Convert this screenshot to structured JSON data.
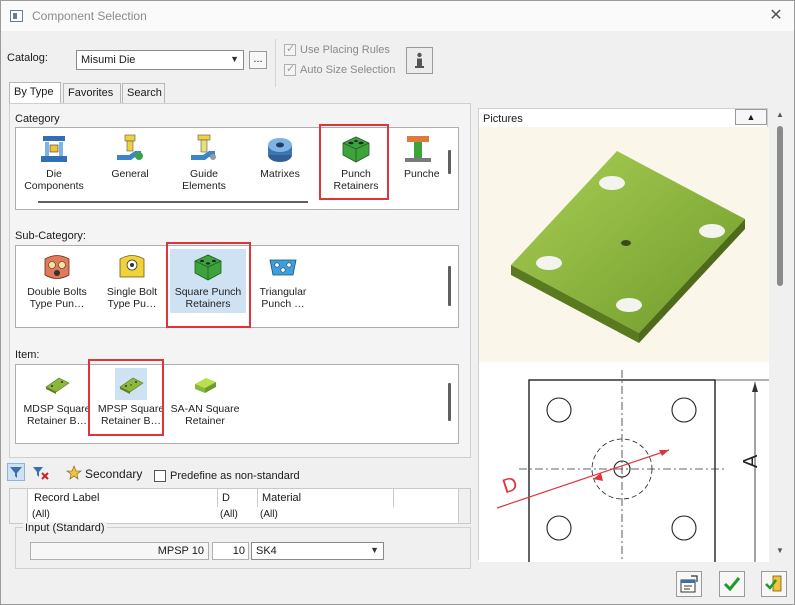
{
  "window": {
    "title": "Component Selection",
    "close_glyph": "✕"
  },
  "catalog": {
    "label": "Catalog:",
    "value": "Misumi Die",
    "browse": "..."
  },
  "options": {
    "use_placing_rules": {
      "label": "Use Placing Rules",
      "checked": true
    },
    "auto_size_selection": {
      "label": "Auto Size Selection",
      "checked": true
    },
    "info_glyph": "i"
  },
  "tabs": [
    {
      "label": "By Type"
    },
    {
      "label": "Favorites"
    },
    {
      "label": "Search"
    }
  ],
  "category": {
    "label": "Category",
    "items": [
      {
        "l1": "Die",
        "l2": "Components",
        "icon": "die-components-icon"
      },
      {
        "l1": "General",
        "l2": "",
        "icon": "general-icon"
      },
      {
        "l1": "Guide",
        "l2": "Elements",
        "icon": "guide-elements-icon"
      },
      {
        "l1": "Matrixes",
        "l2": "",
        "icon": "matrixes-icon"
      },
      {
        "l1": "Punch",
        "l2": "Retainers",
        "icon": "punch-retainers-icon"
      },
      {
        "l1": "Punche",
        "l2": "",
        "icon": "punches-icon"
      }
    ]
  },
  "sub_category": {
    "label": "Sub-Category:",
    "items": [
      {
        "l1": "Double Bolts",
        "l2": "Type Pun…"
      },
      {
        "l1": "Single Bolt",
        "l2": "Type Pu…"
      },
      {
        "l1": "Square Punch",
        "l2": "Retainers"
      },
      {
        "l1": "Triangular",
        "l2": "Punch …"
      }
    ]
  },
  "item": {
    "label": "Item:",
    "items": [
      {
        "l1": "MDSP Square",
        "l2": "Retainer B…"
      },
      {
        "l1": "MPSP Square",
        "l2": "Retainer B…"
      },
      {
        "l1": "SA-AN Square",
        "l2": "Retainer"
      }
    ]
  },
  "bottom_toolbar": {
    "secondary": "Secondary",
    "predefine": {
      "label": "Predefine as non-standard",
      "checked": false
    }
  },
  "table": {
    "columns": [
      "Record Label",
      "D",
      "Material"
    ],
    "filters": [
      "(All)",
      "(All)",
      "(All)"
    ]
  },
  "input": {
    "label": "Input (Standard)",
    "name": "MPSP 10",
    "d": "10",
    "material": "SK4"
  },
  "pictures": {
    "label": "Pictures",
    "collapse_glyph": "▲",
    "dim_d": "D",
    "dim_a": "A"
  },
  "colors": {
    "accent_red": "#e0343c",
    "part_green": "#8db63c",
    "selection": "#cfe2f3"
  }
}
